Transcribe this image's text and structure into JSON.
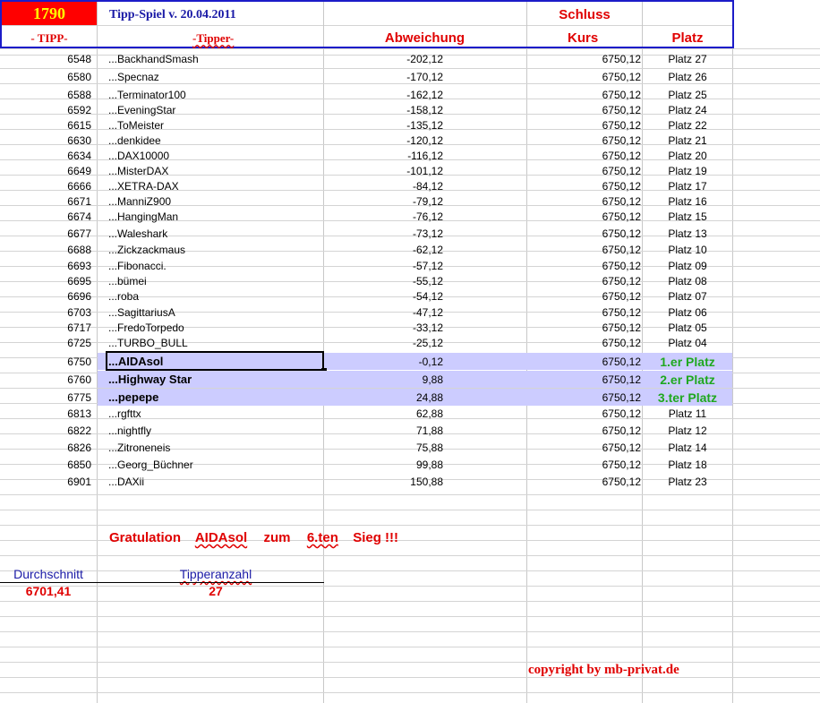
{
  "header": {
    "count_badge": "1790",
    "title": "Tipp-Spiel v. 20.04.2011",
    "schluss": "Schluss",
    "col_tipp": "- TIPP-",
    "col_tipper": "-Tipper-",
    "col_abweichung": "Abweichung",
    "col_kurs": "Kurs",
    "col_platz": "Platz"
  },
  "colors": {
    "badge_bg": "#ff0000",
    "badge_text": "#ffff00",
    "header_border": "#1c1cc8",
    "highlight_bg": "#ccccff",
    "winner_text": "#1fa81f"
  },
  "rows": [
    {
      "tipp": "6548",
      "tipper": "...BackhandSmash",
      "abweichung": "-202,12",
      "kurs": "6750,12",
      "platz": "Platz 27"
    },
    {
      "tipp": "6580",
      "tipper": "...Specnaz",
      "abweichung": "-170,12",
      "kurs": "6750,12",
      "platz": "Platz 26"
    },
    {
      "tipp": "6588",
      "tipper": "...Terminator100",
      "abweichung": "-162,12",
      "kurs": "6750,12",
      "platz": "Platz 25"
    },
    {
      "tipp": "6592",
      "tipper": "...EveningStar",
      "abweichung": "-158,12",
      "kurs": "6750,12",
      "platz": "Platz 24"
    },
    {
      "tipp": "6615",
      "tipper": "...ToMeister",
      "abweichung": "-135,12",
      "kurs": "6750,12",
      "platz": "Platz 22"
    },
    {
      "tipp": "6630",
      "tipper": "...denkidee",
      "abweichung": "-120,12",
      "kurs": "6750,12",
      "platz": "Platz 21"
    },
    {
      "tipp": "6634",
      "tipper": "...DAX10000",
      "abweichung": "-116,12",
      "kurs": "6750,12",
      "platz": "Platz 20"
    },
    {
      "tipp": "6649",
      "tipper": "...MisterDAX",
      "abweichung": "-101,12",
      "kurs": "6750,12",
      "platz": "Platz 19"
    },
    {
      "tipp": "6666",
      "tipper": "...XETRA-DAX",
      "abweichung": "-84,12",
      "kurs": "6750,12",
      "platz": "Platz 17"
    },
    {
      "tipp": "6671",
      "tipper": "...ManniZ900",
      "abweichung": "-79,12",
      "kurs": "6750,12",
      "platz": "Platz 16"
    },
    {
      "tipp": "6674",
      "tipper": "...HangingMan",
      "abweichung": "-76,12",
      "kurs": "6750,12",
      "platz": "Platz 15"
    },
    {
      "tipp": "6677",
      "tipper": "...Waleshark",
      "abweichung": "-73,12",
      "kurs": "6750,12",
      "platz": "Platz 13"
    },
    {
      "tipp": "6688",
      "tipper": "...Zickzackmaus",
      "abweichung": "-62,12",
      "kurs": "6750,12",
      "platz": "Platz 10"
    },
    {
      "tipp": "6693",
      "tipper": "...Fibonacci.",
      "abweichung": "-57,12",
      "kurs": "6750,12",
      "platz": "Platz 09"
    },
    {
      "tipp": "6695",
      "tipper": "...bümei",
      "abweichung": "-55,12",
      "kurs": "6750,12",
      "platz": "Platz 08"
    },
    {
      "tipp": "6696",
      "tipper": "...roba",
      "abweichung": "-54,12",
      "kurs": "6750,12",
      "platz": "Platz 07"
    },
    {
      "tipp": "6703",
      "tipper": "...SagittariusA",
      "abweichung": "-47,12",
      "kurs": "6750,12",
      "platz": "Platz 06"
    },
    {
      "tipp": "6717",
      "tipper": "...FredoTorpedo",
      "abweichung": "-33,12",
      "kurs": "6750,12",
      "platz": "Platz 05"
    },
    {
      "tipp": "6725",
      "tipper": "...TURBO_BULL",
      "abweichung": "-25,12",
      "kurs": "6750,12",
      "platz": "Platz 04"
    }
  ],
  "winners": [
    {
      "tipp": "6750",
      "tipper": "...AIDAsol",
      "abweichung": "-0,12",
      "kurs": "6750,12",
      "platz": "1.er Platz"
    },
    {
      "tipp": "6760",
      "tipper": "...Highway Star",
      "abweichung": "9,88",
      "kurs": "6750,12",
      "platz": "2.er Platz"
    },
    {
      "tipp": "6775",
      "tipper": "...pepepe",
      "abweichung": "24,88",
      "kurs": "6750,12",
      "platz": "3.ter Platz"
    }
  ],
  "rows_after": [
    {
      "tipp": "6813",
      "tipper": "...rgfttx",
      "abweichung": "62,88",
      "kurs": "6750,12",
      "platz": "Platz 11"
    },
    {
      "tipp": "6822",
      "tipper": "...nightfly",
      "abweichung": "71,88",
      "kurs": "6750,12",
      "platz": "Platz 12"
    },
    {
      "tipp": "6826",
      "tipper": "...Zitroneneis",
      "abweichung": "75,88",
      "kurs": "6750,12",
      "platz": "Platz 14"
    },
    {
      "tipp": "6850",
      "tipper": "...Georg_Büchner",
      "abweichung": "99,88",
      "kurs": "6750,12",
      "platz": "Platz 18"
    },
    {
      "tipp": "6901",
      "tipper": "...DAXii",
      "abweichung": "150,88",
      "kurs": "6750,12",
      "platz": "Platz 23"
    }
  ],
  "gratulation": {
    "w1": "Gratulation",
    "w2": "AIDAsol",
    "w3": "zum",
    "w4": "6.ten",
    "w5": "Sieg !!!"
  },
  "stats": {
    "avg_label": "Durchschnitt",
    "avg_value": "6701,41",
    "count_label": "Tipperanzahl",
    "count_value": "27"
  },
  "copyright": "copyright by mb-privat.de"
}
